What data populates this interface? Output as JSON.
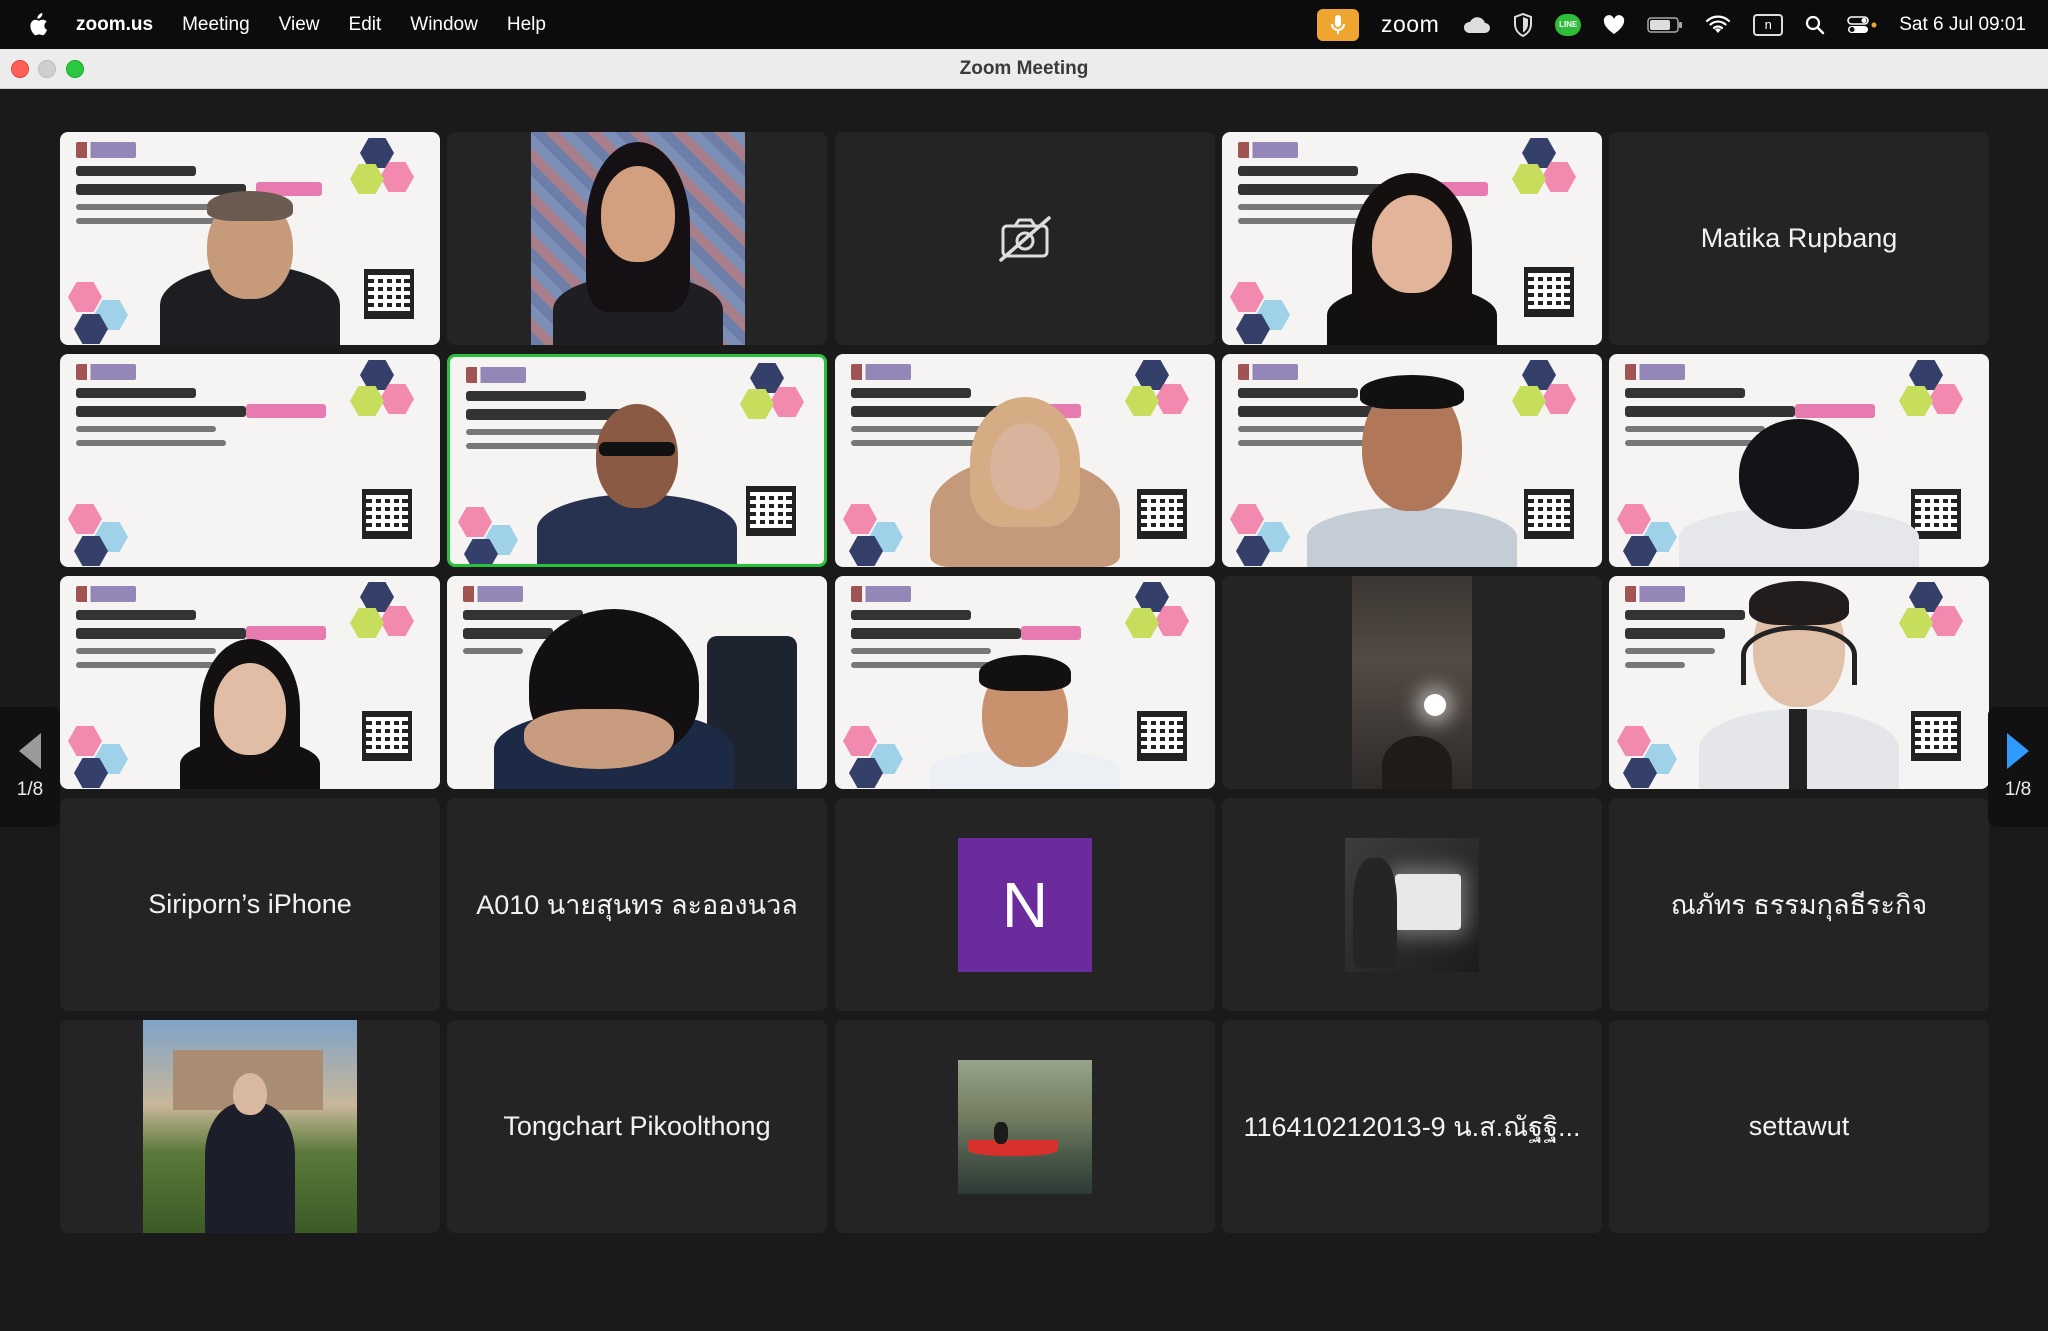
{
  "menubar": {
    "app_name": "zoom.us",
    "items": [
      "Meeting",
      "View",
      "Edit",
      "Window",
      "Help"
    ],
    "zoom_label": "zoom",
    "line_badge": "LINE",
    "n_badge": "n",
    "clock": "Sat 6 Jul  09:01"
  },
  "window": {
    "title": "Zoom Meeting"
  },
  "pager": {
    "left_label": "1/8",
    "right_label": "1/8"
  },
  "colors": {
    "active_speaker_border": "#28c13c",
    "next_arrow": "#2f9bff",
    "avatar_n_bg": "#6b2b9c",
    "mic_badge": "#f0a530"
  },
  "tiles": {
    "r1c5_name": "Matika Rupbang",
    "r4c1_name": "Siriporn’s iPhone",
    "r4c2_name": "A010 นายสุนทร ละอองนวล",
    "r4c3_initial": "N",
    "r4c5_name": "ณภัทร ธรรมกุลธีระกิจ",
    "r5c2_name": "Tongchart Pikoolthong",
    "r5c4_name": "116410212013-9 น.ส.ณัฐฐิ...",
    "r5c5_name": "settawut"
  }
}
